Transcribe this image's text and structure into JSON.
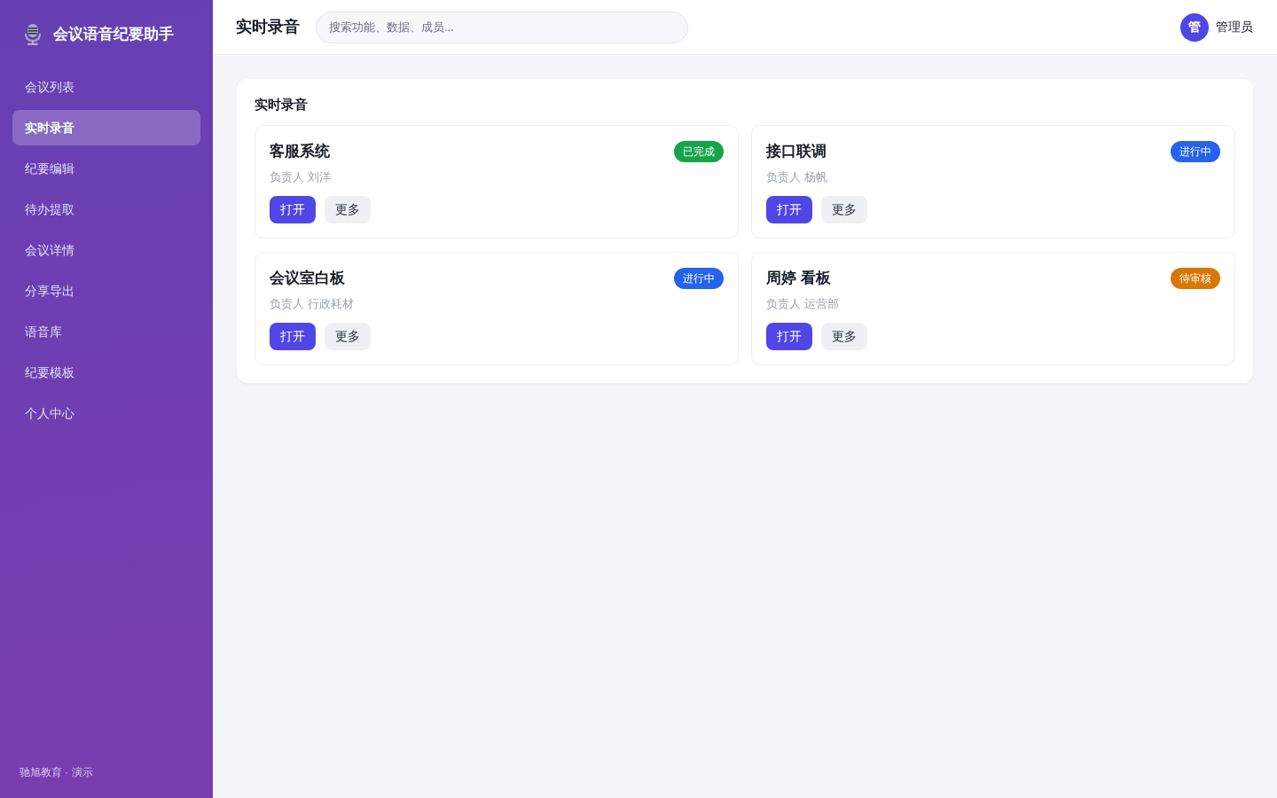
{
  "sidebar": {
    "brand": "会议语音纪要助手",
    "items": [
      {
        "label": "会议列表",
        "selected": false
      },
      {
        "label": "实时录音",
        "selected": true
      },
      {
        "label": "纪要编辑",
        "selected": false
      },
      {
        "label": "待办提取",
        "selected": false
      },
      {
        "label": "会议详情",
        "selected": false
      },
      {
        "label": "分享导出",
        "selected": false
      },
      {
        "label": "语音库",
        "selected": false
      },
      {
        "label": "纪要模板",
        "selected": false
      },
      {
        "label": "个人中心",
        "selected": false
      }
    ],
    "footer": "驰旭教育 · 演示"
  },
  "topbar": {
    "title": "实时录音",
    "search": {
      "placeholder": "搜索功能、数据、成员..."
    },
    "user": {
      "avatar": "管",
      "name": "管理员"
    }
  },
  "panel": {
    "title": "实时录音",
    "cards": [
      {
        "title": "客服系统",
        "status": "已完成",
        "color": "#16a34a",
        "owner": "负责人 刘洋",
        "actions": [
          {
            "label": "打开",
            "kind": "primary"
          },
          {
            "label": "更多",
            "kind": "secondary"
          }
        ]
      },
      {
        "title": "接口联调",
        "status": "进行中",
        "color": "#2563eb",
        "owner": "负责人 杨帆",
        "actions": [
          {
            "label": "打开",
            "kind": "primary"
          },
          {
            "label": "更多",
            "kind": "secondary"
          }
        ]
      },
      {
        "title": "会议室白板",
        "status": "进行中",
        "color": "#2563eb",
        "owner": "负责人 行政耗材",
        "actions": [
          {
            "label": "打开",
            "kind": "primary"
          },
          {
            "label": "更多",
            "kind": "secondary"
          }
        ]
      },
      {
        "title": "周婷 看板",
        "status": "待审核",
        "color": "#d97706",
        "owner": "负责人 运营部",
        "actions": [
          {
            "label": "打开",
            "kind": "primary"
          },
          {
            "label": "更多",
            "kind": "secondary"
          }
        ]
      }
    ]
  }
}
